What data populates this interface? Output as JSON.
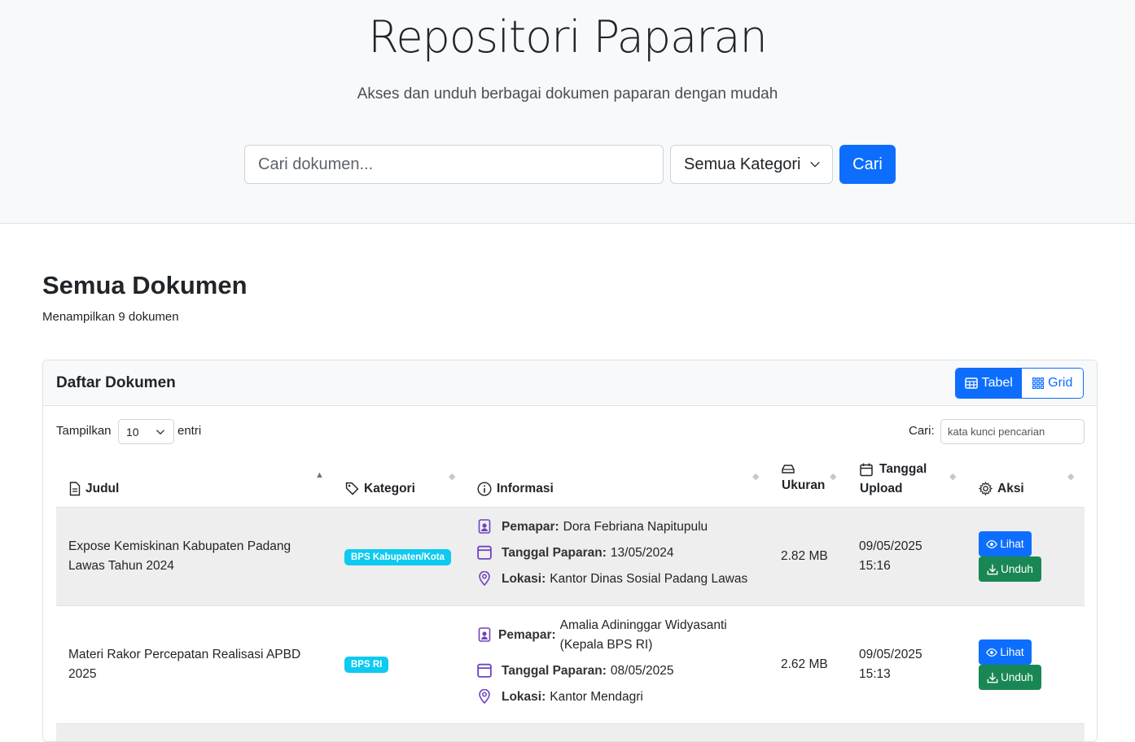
{
  "hero": {
    "title": "Repositori Paparan",
    "subtitle": "Akses dan unduh berbagai dokumen paparan dengan mudah",
    "search_placeholder": "Cari dokumen...",
    "category_selected": "Semua Kategori",
    "search_button": "Cari"
  },
  "section": {
    "title": "Semua Dokumen",
    "count_text": "Menampilkan 9 dokumen"
  },
  "card": {
    "title": "Daftar Dokumen",
    "view_table": "Tabel",
    "view_grid": "Grid",
    "show_label": "Tampilkan",
    "show_value": "10",
    "show_after": "entri",
    "find_label": "Cari:",
    "find_placeholder": "kata kunci pencarian"
  },
  "columns": {
    "title": "Judul",
    "category": "Kategori",
    "info": "Informasi",
    "size": "Ukuran",
    "uploaded_1": "Tanggal",
    "uploaded_2": "Upload",
    "actions": "Aksi"
  },
  "labels": {
    "presenter": "Pemapar:",
    "date": "Tanggal Paparan:",
    "location": "Lokasi:",
    "view": "Lihat",
    "download": "Unduh"
  },
  "rows": [
    {
      "title_1": "Expose Kemiskinan Kabupaten Padang",
      "title_2": "Lawas Tahun 2024",
      "category": "BPS Kabupaten/Kota",
      "presenter": "Dora Febriana Napitupulu",
      "date": "13/05/2024",
      "location": "Kantor Dinas Sosial Padang Lawas",
      "size": "2.82 MB",
      "uploaded_date": "09/05/2025",
      "uploaded_time": "15:16"
    },
    {
      "title_1": "Materi Rakor Percepatan Realisasi APBD",
      "title_2": "2025",
      "category": "BPS RI",
      "presenter_1": "Amalia Adininggar Widyasanti",
      "presenter_2": "(Kepala BPS RI)",
      "date": "08/05/2025",
      "location": "Kantor Mendagri",
      "size": "2.62 MB",
      "uploaded_date": "09/05/2025",
      "uploaded_time": "15:13"
    }
  ],
  "colors": {
    "primary": "#0d6efd",
    "success": "#198754",
    "info_badge": "#0dcaf0",
    "icon_purple": "#6f42c1"
  }
}
